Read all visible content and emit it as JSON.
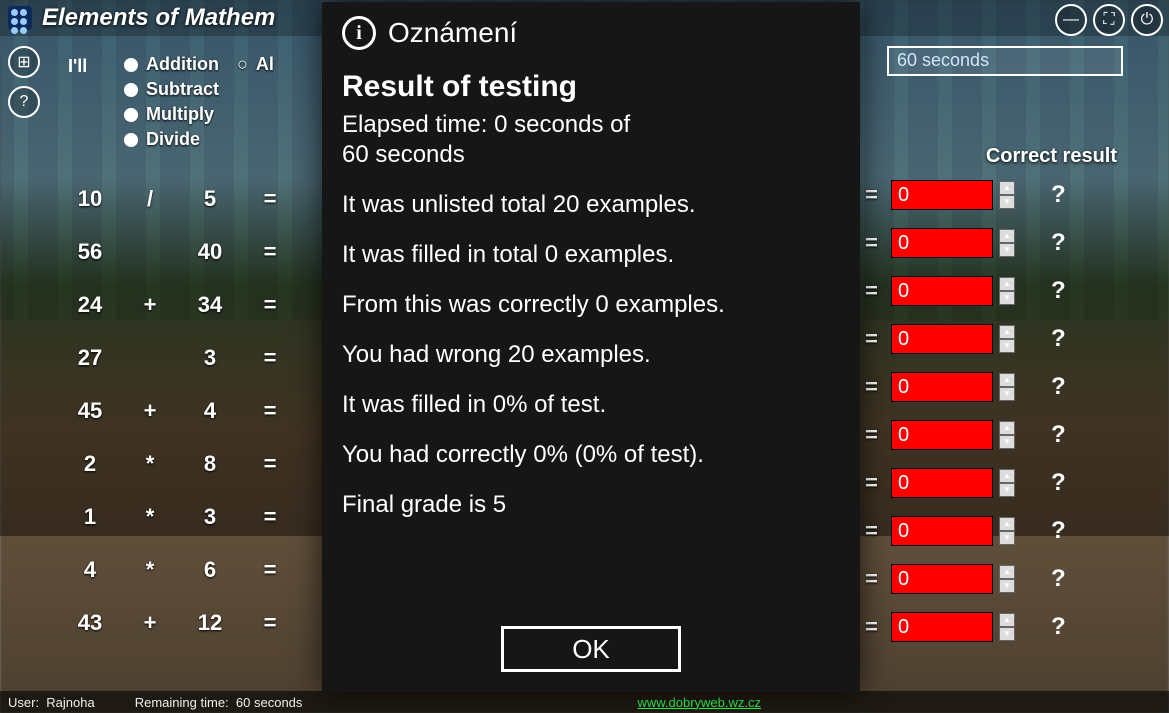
{
  "app_title": "Elements of Mathem",
  "sidebar": {
    "ill": "I'll"
  },
  "options": {
    "items": [
      "Addition",
      "Subtract",
      "Multiply",
      "Divide"
    ],
    "all": "Al"
  },
  "timer": {
    "value": "60 seconds"
  },
  "correct_header": "Correct result",
  "math": {
    "rows": [
      {
        "a": "10",
        "op": "/",
        "b": "5",
        "eq": "="
      },
      {
        "a": "",
        "op": "",
        "b": "",
        "eq": ""
      },
      {
        "a": "56",
        "op": "",
        "b": "40",
        "eq": "="
      },
      {
        "a": "24",
        "op": "+",
        "b": "34",
        "eq": "="
      },
      {
        "a": "27",
        "op": "",
        "b": "3",
        "eq": "="
      },
      {
        "a": "45",
        "op": "+",
        "b": "4",
        "eq": "="
      },
      {
        "a": "2",
        "op": "*",
        "b": "8",
        "eq": "="
      },
      {
        "a": "1",
        "op": "*",
        "b": "3",
        "eq": "="
      },
      {
        "a": "4",
        "op": "*",
        "b": "6",
        "eq": "="
      },
      {
        "a": "43",
        "op": "+",
        "b": "12",
        "eq": "="
      }
    ]
  },
  "answers": {
    "rows": [
      {
        "val": "0"
      },
      {
        "val": "0"
      },
      {
        "val": "0"
      },
      {
        "val": "0"
      },
      {
        "val": "0"
      },
      {
        "val": "0"
      },
      {
        "val": "0"
      },
      {
        "val": "0"
      },
      {
        "val": "0"
      },
      {
        "val": "0"
      }
    ],
    "eq": "=",
    "qm": "?"
  },
  "status": {
    "user_label": "User:",
    "user": "Rajnoha",
    "rem_label": "Remaining time:",
    "rem": "60 seconds",
    "link": "www.dobryweb.wz.cz"
  },
  "modal": {
    "title": "Oznámení",
    "result_title": "Result of testing",
    "elapsed_l1": "Elapsed time: 0 seconds of",
    "elapsed_l2": " 60 seconds",
    "p1": "It was unlisted total 20 examples.",
    "p2": "It was filled in total 0 examples.",
    "p3": "From this was correctly 0 examples.",
    "p4": "You had wrong 20 examples.",
    "p5": "It was filled in 0% of test.",
    "p6": "You had correctly 0% (0% of test).",
    "p7": "Final grade is 5",
    "ok": "OK"
  }
}
